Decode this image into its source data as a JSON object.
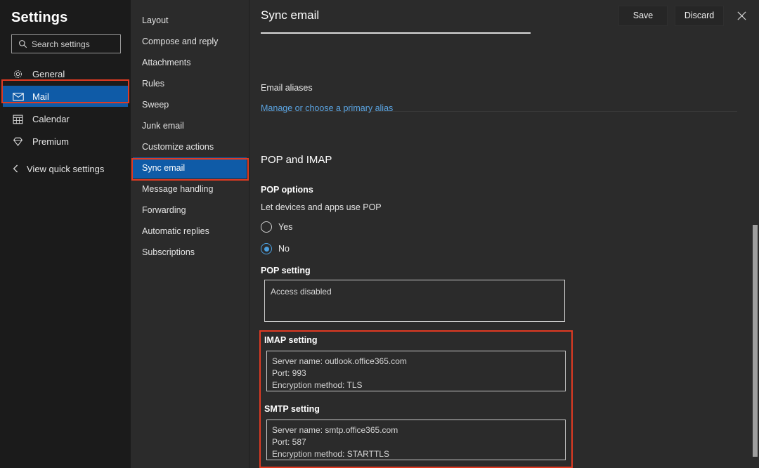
{
  "sidebar": {
    "title": "Settings",
    "search": {
      "placeholder": "Search settings",
      "value": "",
      "icon": "search-icon"
    },
    "items": [
      {
        "label": "General",
        "icon": "gear-icon",
        "selected": false
      },
      {
        "label": "Mail",
        "icon": "envelope-icon",
        "selected": true
      },
      {
        "label": "Calendar",
        "icon": "calendar-icon",
        "selected": false
      },
      {
        "label": "Premium",
        "icon": "diamond-icon",
        "selected": false
      }
    ],
    "quick_settings": {
      "label": "View quick settings",
      "icon": "chevron-left-icon"
    },
    "selected_highlight_color": "#e03a22",
    "selected_background_color": "#0f5ba7"
  },
  "midnav": {
    "items": [
      {
        "label": "Layout",
        "selected": false
      },
      {
        "label": "Compose and reply",
        "selected": false
      },
      {
        "label": "Attachments",
        "selected": false
      },
      {
        "label": "Rules",
        "selected": false
      },
      {
        "label": "Sweep",
        "selected": false
      },
      {
        "label": "Junk email",
        "selected": false
      },
      {
        "label": "Customize actions",
        "selected": false
      },
      {
        "label": "Sync email",
        "selected": true
      },
      {
        "label": "Message handling",
        "selected": false
      },
      {
        "label": "Forwarding",
        "selected": false
      },
      {
        "label": "Automatic replies",
        "selected": false
      },
      {
        "label": "Subscriptions",
        "selected": false
      }
    ]
  },
  "main": {
    "title": "Sync email",
    "save_label": "Save",
    "discard_label": "Discard",
    "close_icon": "close-icon",
    "aliases_label": "Email aliases",
    "aliases_link": "Manage or choose a primary alias",
    "pop_imap_heading": "POP and IMAP",
    "pop_options_heading": "POP options",
    "pop_options_description": "Let devices and apps use POP",
    "radio_yes": "Yes",
    "radio_no": "No",
    "radio_selected": "No",
    "pop_setting_heading": "POP setting",
    "pop_setting_value": "Access disabled",
    "imap_setting_heading": "IMAP setting",
    "imap_server_name": "Server name: outlook.office365.com",
    "imap_port": "Port: 993",
    "imap_encryption": "Encryption method: TLS",
    "smtp_setting_heading": "SMTP setting",
    "smtp_server_name": "Server name: smtp.office365.com",
    "smtp_port": "Port: 587",
    "smtp_encryption": "Encryption method: STARTTLS",
    "highlight_color": "#e03a22",
    "link_color": "#5aa3e0",
    "radio_accent_color": "#4ca0e0"
  }
}
